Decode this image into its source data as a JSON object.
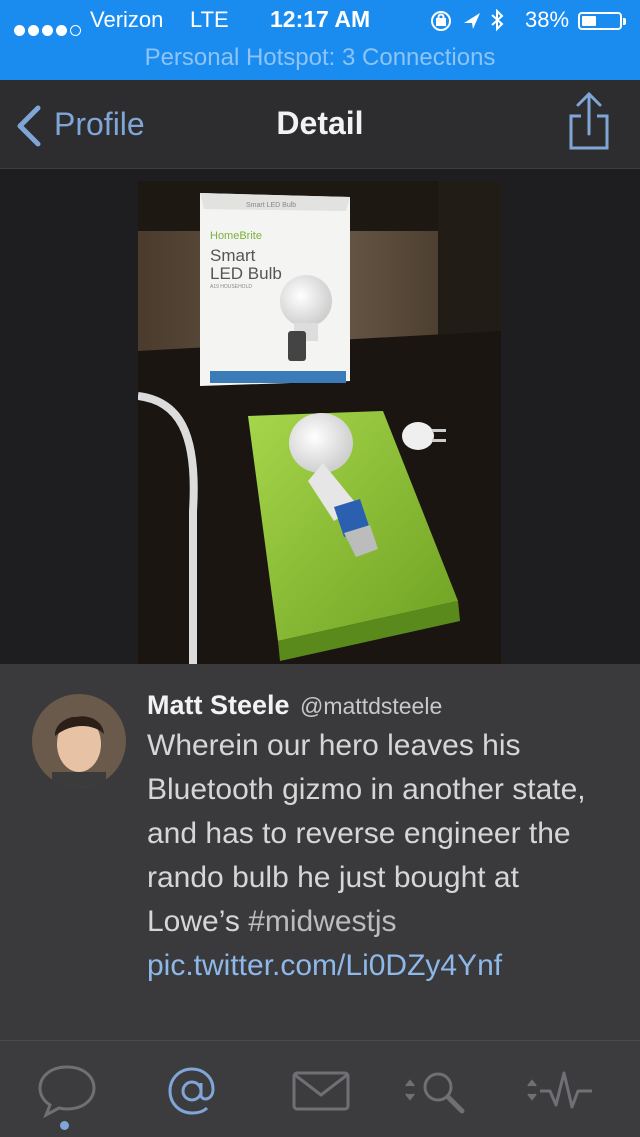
{
  "status": {
    "carrier": "Verizon",
    "network": "LTE",
    "time": "12:17 AM",
    "battery": "38%",
    "battery_level": 0.38,
    "hotspot": "Personal Hotspot: 3 Connections"
  },
  "nav": {
    "back_label": "Profile",
    "title": "Detail"
  },
  "tweet": {
    "name": "Matt Steele",
    "handle": "@mattdsteele",
    "text_main": "Wherein our hero leaves his Bluetooth gizmo in another state, and has to reverse engineer the rando bulb he just bought at Lowe’s",
    "hashtag": "#midwestjs",
    "link": "pic.twitter.com/Li0DZy4Ynf"
  },
  "photo": {
    "box_brand": "HomeBrite",
    "box_title_1": "Smart",
    "box_title_2": "LED Bulb",
    "box_sub": "A19 HOUSEHOLD",
    "box_side": "Smart LED Bulb"
  },
  "tabs": [
    {
      "icon": "chat-bubble-icon",
      "active": false
    },
    {
      "icon": "mentions-icon",
      "active": false
    },
    {
      "icon": "messages-icon",
      "active": false
    },
    {
      "icon": "search-icon",
      "active": false
    },
    {
      "icon": "activity-icon",
      "active": false
    }
  ],
  "colors": {
    "status_bar": "#1a8cf0",
    "nav_bg": "#2d2d2f",
    "accent": "#7fa6d6",
    "tweet_bg": "#3a3a3c",
    "tabbar_bg": "#3c3c3e"
  }
}
